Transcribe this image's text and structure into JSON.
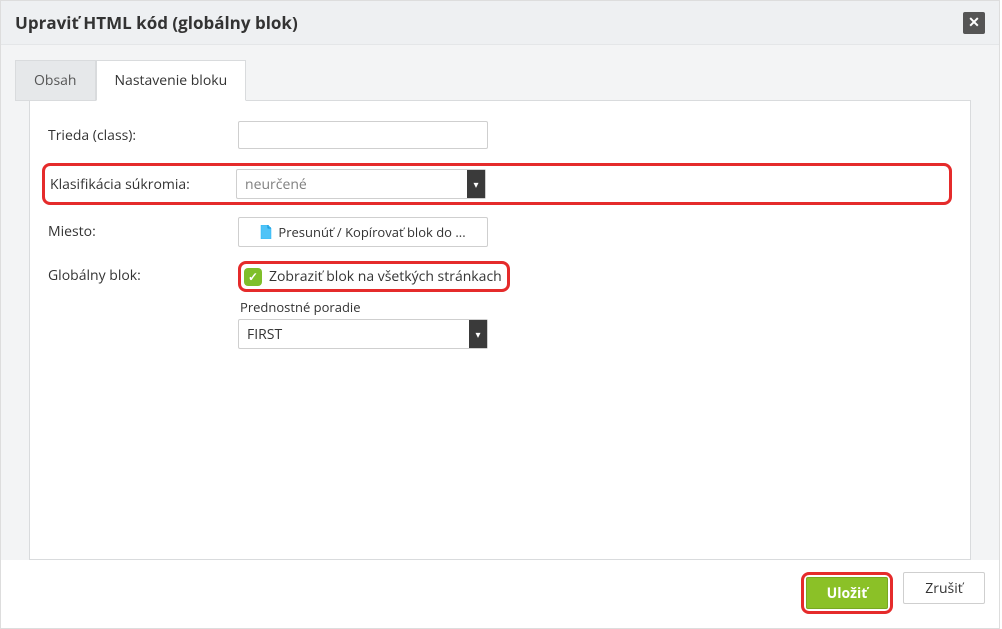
{
  "header": {
    "title": "Upraviť HTML kód (globálny blok)"
  },
  "tabs": {
    "content": "Obsah",
    "settings": "Nastavenie bloku"
  },
  "form": {
    "class_label": "Trieda (class):",
    "class_value": "",
    "privacy_label": "Klasifikácia súkromia:",
    "privacy_value": "neurčené",
    "place_label": "Miesto:",
    "move_button": "Presunúť / Kopírovať blok do ...",
    "global_label": "Globálny blok:",
    "global_checkbox": "Zobraziť blok na všetkých stránkach",
    "priority_label": "Prednostné poradie",
    "priority_value": "FIRST"
  },
  "footer": {
    "save": "Uložiť",
    "cancel": "Zrušiť"
  }
}
